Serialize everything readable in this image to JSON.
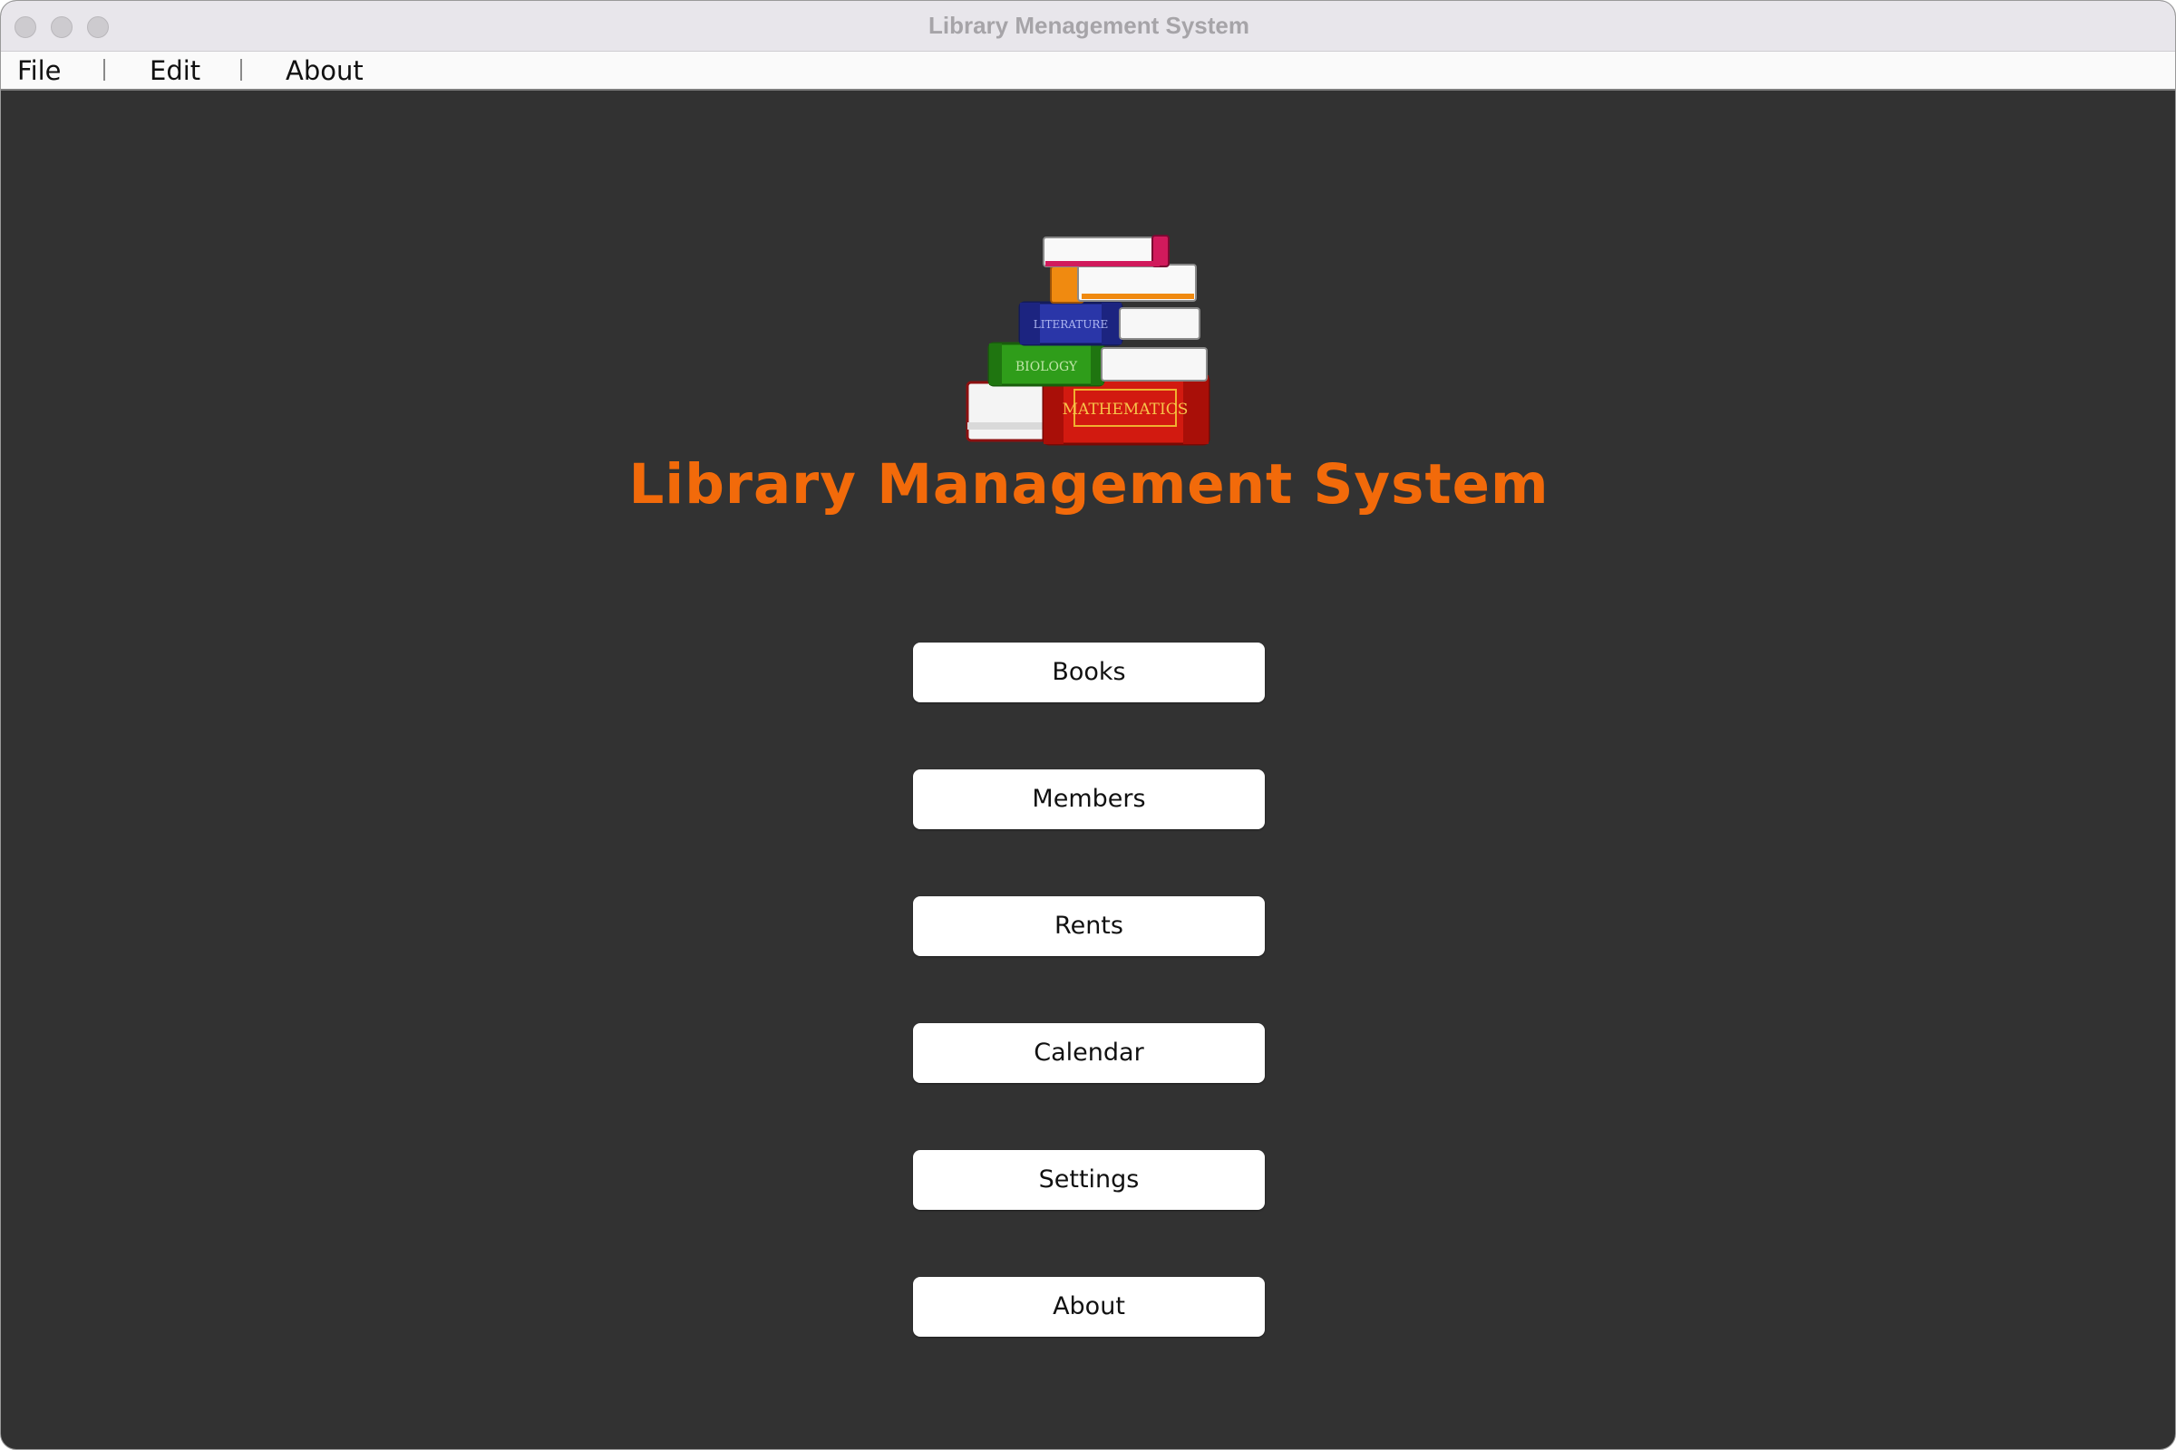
{
  "window": {
    "title": "Library Menagement System"
  },
  "menubar": {
    "items": [
      {
        "label": "File"
      },
      {
        "label": "Edit"
      },
      {
        "label": "About"
      }
    ]
  },
  "main": {
    "logo": {
      "icon": "book-stack-icon",
      "spines": [
        "MATHEMATICS",
        "BIOLOGY",
        "LITERATURE"
      ]
    },
    "title": "Library Management System",
    "title_color": "#f26a0a",
    "buttons": [
      {
        "label": "Books"
      },
      {
        "label": "Members"
      },
      {
        "label": "Rents"
      },
      {
        "label": "Calendar"
      },
      {
        "label": "Settings"
      },
      {
        "label": "About"
      }
    ]
  },
  "colors": {
    "background": "#323232",
    "button": "#ffffff",
    "accent": "#f26a0a"
  }
}
